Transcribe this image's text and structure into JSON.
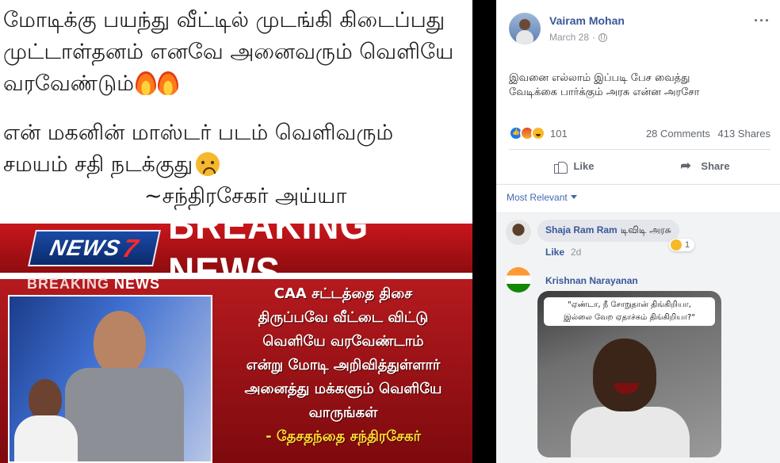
{
  "meme": {
    "lines": [
      "மோடிக்கு பயந்து வீட்டில் முடங்கி கிடைப்பது",
      "முட்டாள்தனம் எனவே அனைவரும் வெளியே",
      "வரவேண்டும்"
    ],
    "lines2": [
      "என் மகனின் மாஸ்டர் படம் வெளிவரும்",
      "சமயம் சதி நடக்குது"
    ],
    "signature": "~சந்திரசேகர் அய்யா",
    "news_logo": "NEWS",
    "news_logo_num": "7",
    "news_title": "BREAKING NEWS",
    "news_sub_a": "BREAKING",
    "news_sub_b": "NEWS",
    "news_caption": [
      "CAA சட்டத்தை திசை",
      "திருப்பவே வீட்டை விட்டு",
      "வெளியே வரவேண்டாம்",
      "என்று மோடி அறிவித்துள்ளார்",
      "அனைத்து மக்களும் வெளியே",
      "வாருங்கள்"
    ],
    "news_caption_sig": "- தேசதந்தை சந்திரசேகர்"
  },
  "post": {
    "author": "Vairam Mohan",
    "date": "March 28",
    "date_sep": "·",
    "more": "···",
    "text_line1": "இவனை எல்லாம் இப்படி பேச வைத்து",
    "text_line2": "வேடிக்கை பார்க்கும் அரசு என்ன அரசோ",
    "reaction_count": "101",
    "comments": "28 Comments",
    "shares": "413 Shares",
    "like_label": "Like",
    "share_label": "Share",
    "sort_label": "Most Relevant"
  },
  "comments": [
    {
      "name": "Shaja Ram Ram",
      "text": "டிவிடி அரசு",
      "reactions": "1",
      "like": "Like",
      "time": "2d"
    },
    {
      "name": "Krishnan Narayanan",
      "image_caption_1": "\"ஏண்டா, நீ சோறுதான் திங்கிறியா,",
      "image_caption_2": "இல்லை வேற ஏதாச்சும் திங்கிறியா?\""
    }
  ]
}
